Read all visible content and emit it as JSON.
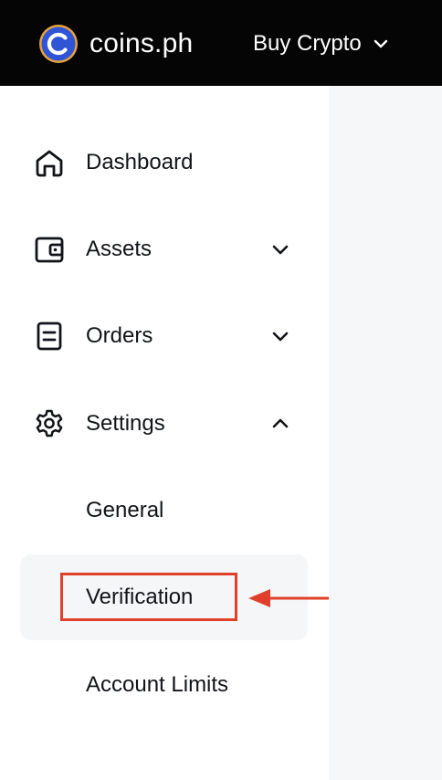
{
  "header": {
    "brand": "coins.ph",
    "buy_crypto_label": "Buy Crypto"
  },
  "sidebar": {
    "items": [
      {
        "label": "Dashboard",
        "icon": "home-icon"
      },
      {
        "label": "Assets",
        "icon": "wallet-icon",
        "expanded": false
      },
      {
        "label": "Orders",
        "icon": "document-icon",
        "expanded": false
      },
      {
        "label": "Settings",
        "icon": "gear-icon",
        "expanded": true
      }
    ],
    "settings_sub_items": [
      {
        "label": "General"
      },
      {
        "label": "Verification",
        "active": true
      },
      {
        "label": "Account Limits"
      }
    ]
  },
  "colors": {
    "topbar": "#050505",
    "logo_blue": "#2f54d6",
    "logo_ring": "#e8a33a",
    "annotation": "#e0402a",
    "content_bg": "#f6f7f9",
    "active_bg": "#f5f6f8"
  }
}
